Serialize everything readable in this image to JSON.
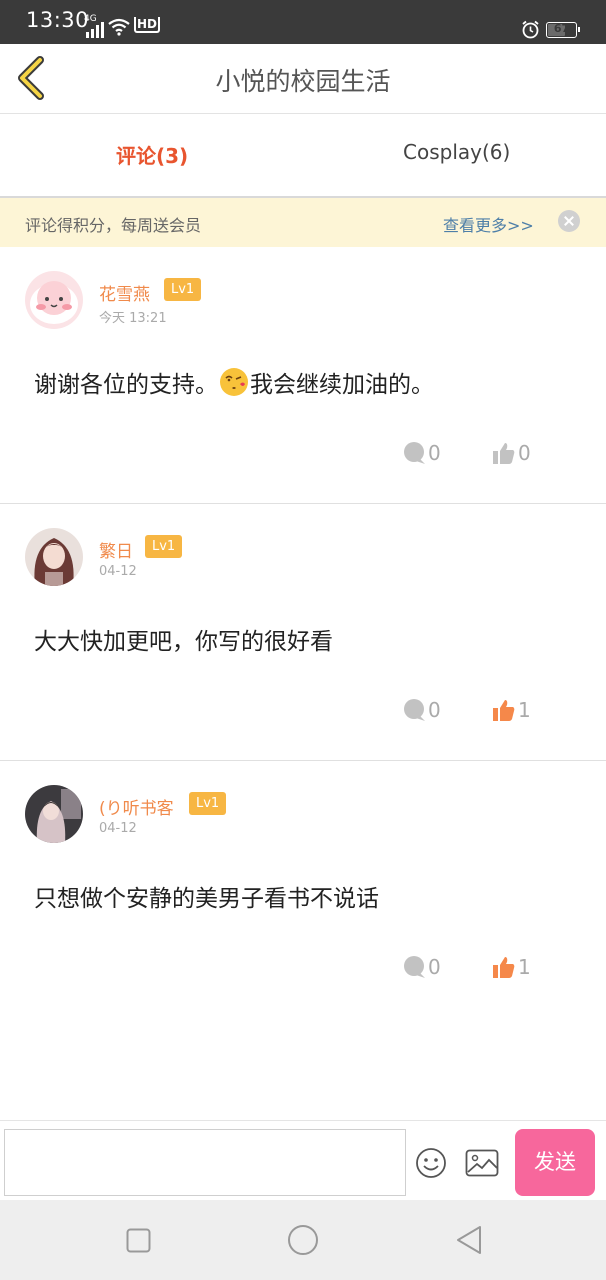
{
  "status_bar": {
    "time": "13:30",
    "network": "4G",
    "hd": "HD",
    "battery": "67",
    "battery_level": 0.67
  },
  "header": {
    "back_icon": "chevron-left-icon",
    "title": "小悦的校园生活"
  },
  "tabs": [
    {
      "label": "评论(3)",
      "active": true
    },
    {
      "label": "Cosplay(6)",
      "active": false
    }
  ],
  "notice": {
    "text": "评论得积分，每周送会员",
    "more": "查看更多>>"
  },
  "comments": [
    {
      "name": "花雪燕",
      "level": "Lv1",
      "date": "今天 13:21",
      "body_before": "谢谢各位的支持。",
      "body_emoji": "kiss-emoji",
      "body_after": "我会继续加油的。",
      "replies": "0",
      "likes": "0",
      "liked": false
    },
    {
      "name": "繁日",
      "level": "Lv1",
      "date": "04-12",
      "body_before": "大大快加更吧，你写的很好看",
      "body_emoji": "",
      "body_after": "",
      "replies": "0",
      "likes": "1",
      "liked": true
    },
    {
      "name": "(り听书客",
      "level": "Lv1",
      "date": "04-12",
      "body_before": "只想做个安静的美男子看书不说话",
      "body_emoji": "",
      "body_after": "",
      "replies": "0",
      "likes": "1",
      "liked": true
    }
  ],
  "input_bar": {
    "placeholder": "",
    "send_label": "发送"
  },
  "colors": {
    "accent": "#e8552f",
    "name": "#f08a4b",
    "level_badge": "#f7b643",
    "send": "#f7679c",
    "liked": "#f5884a",
    "notice_bg": "#fdf5d6"
  }
}
